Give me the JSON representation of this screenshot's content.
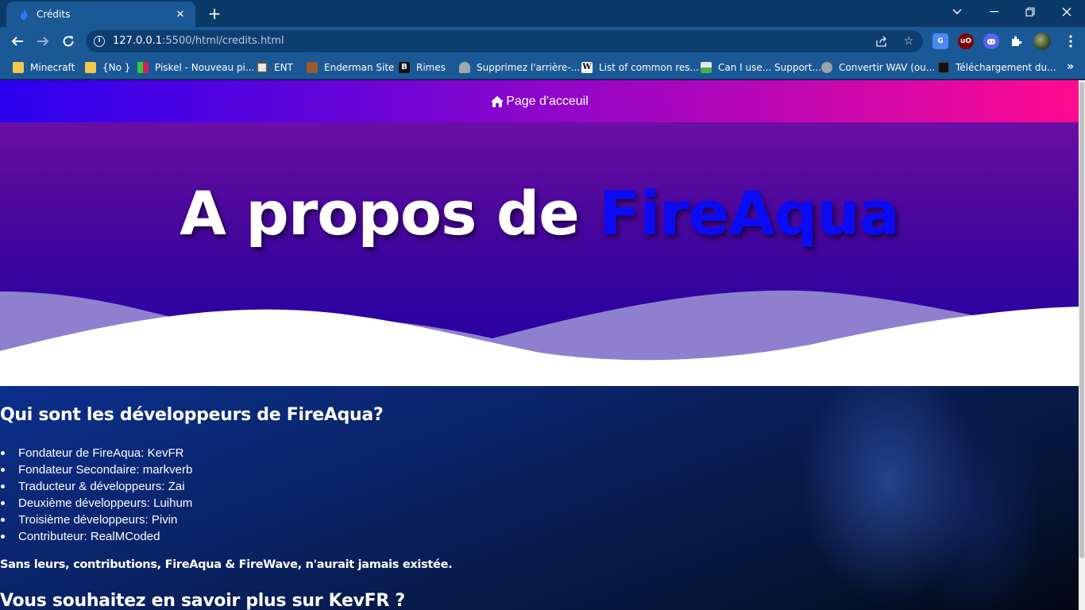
{
  "browser": {
    "tab_title": "Crédits",
    "url_host": "127.0.0.1",
    "url_path": ":5500/html/credits.html",
    "bookmarks": [
      {
        "label": "Minecraft",
        "icon": "folder-icon"
      },
      {
        "label": "{No }",
        "icon": "folder-icon"
      },
      {
        "label": "Piskel - Nouveau pi...",
        "icon": "piskel-icon"
      },
      {
        "label": "ENT",
        "icon": "ent-icon"
      },
      {
        "label": "Enderman Site",
        "icon": "enderman-icon"
      },
      {
        "label": "Rimes",
        "icon": "rimes-icon"
      },
      {
        "label": "Supprimez l'arrière-...",
        "icon": "removebg-icon"
      },
      {
        "label": "List of common res...",
        "icon": "wikipedia-icon"
      },
      {
        "label": "Can I use... Support...",
        "icon": "caniuse-icon"
      },
      {
        "label": "Convertir WAV (ou...",
        "icon": "convert-icon"
      },
      {
        "label": "Téléchargement du...",
        "icon": "download-icon"
      }
    ]
  },
  "page": {
    "nav_home": "Page d'acceuil",
    "hero_title_main": "A propos de ",
    "hero_title_accent": "FireAqua",
    "section1_heading": "Qui sont les développeurs de FireAqua?",
    "developers": [
      "Fondateur de FireAqua: KevFR",
      "Fondateur Secondaire: markverb",
      "Traducteur & développeurs: Zai",
      "Deuxième développeurs: Luihum",
      "Troisième développeurs: Pivin",
      "Contributeur: RealMCoded"
    ],
    "thanks_text": "Sans leurs, contributions, FireAqua & FireWave, n'aurait jamais existée.",
    "section2_heading": "Vous souhaitez en savoir plus sur KevFR ?"
  },
  "colors": {
    "accent_blue": "#0a0af5",
    "chrome_bg": "#1a5996",
    "nav_gradient_start": "#2a00ee",
    "nav_gradient_end": "#ff0a90"
  }
}
